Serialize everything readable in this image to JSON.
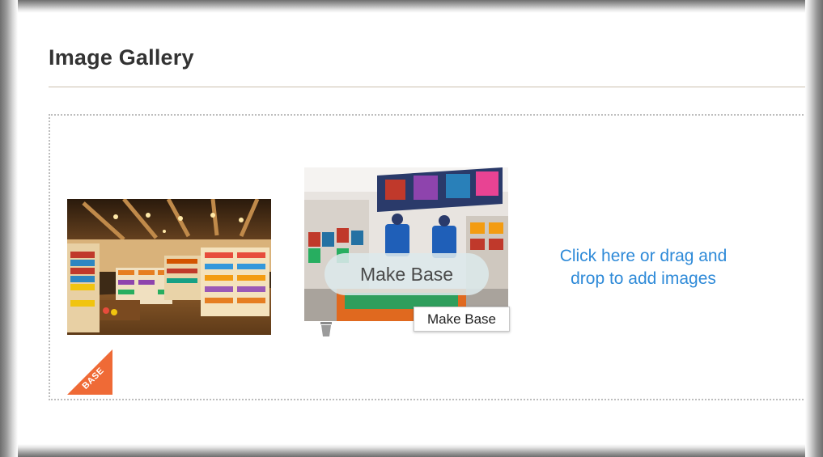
{
  "gallery": {
    "title": "Image Gallery",
    "base_badge": "BASE",
    "make_base_button": "Make Base",
    "make_base_tooltip": "Make Base",
    "upload_prompt": "Click here or drag and drop to add images",
    "accent_color": "#ef6a36",
    "link_color": "#2e8ad8"
  },
  "images": [
    {
      "name": "store-interior-photo",
      "is_base": true
    },
    {
      "name": "sports-store-photo",
      "is_base": false
    }
  ],
  "icons": [
    "trash-icon"
  ]
}
